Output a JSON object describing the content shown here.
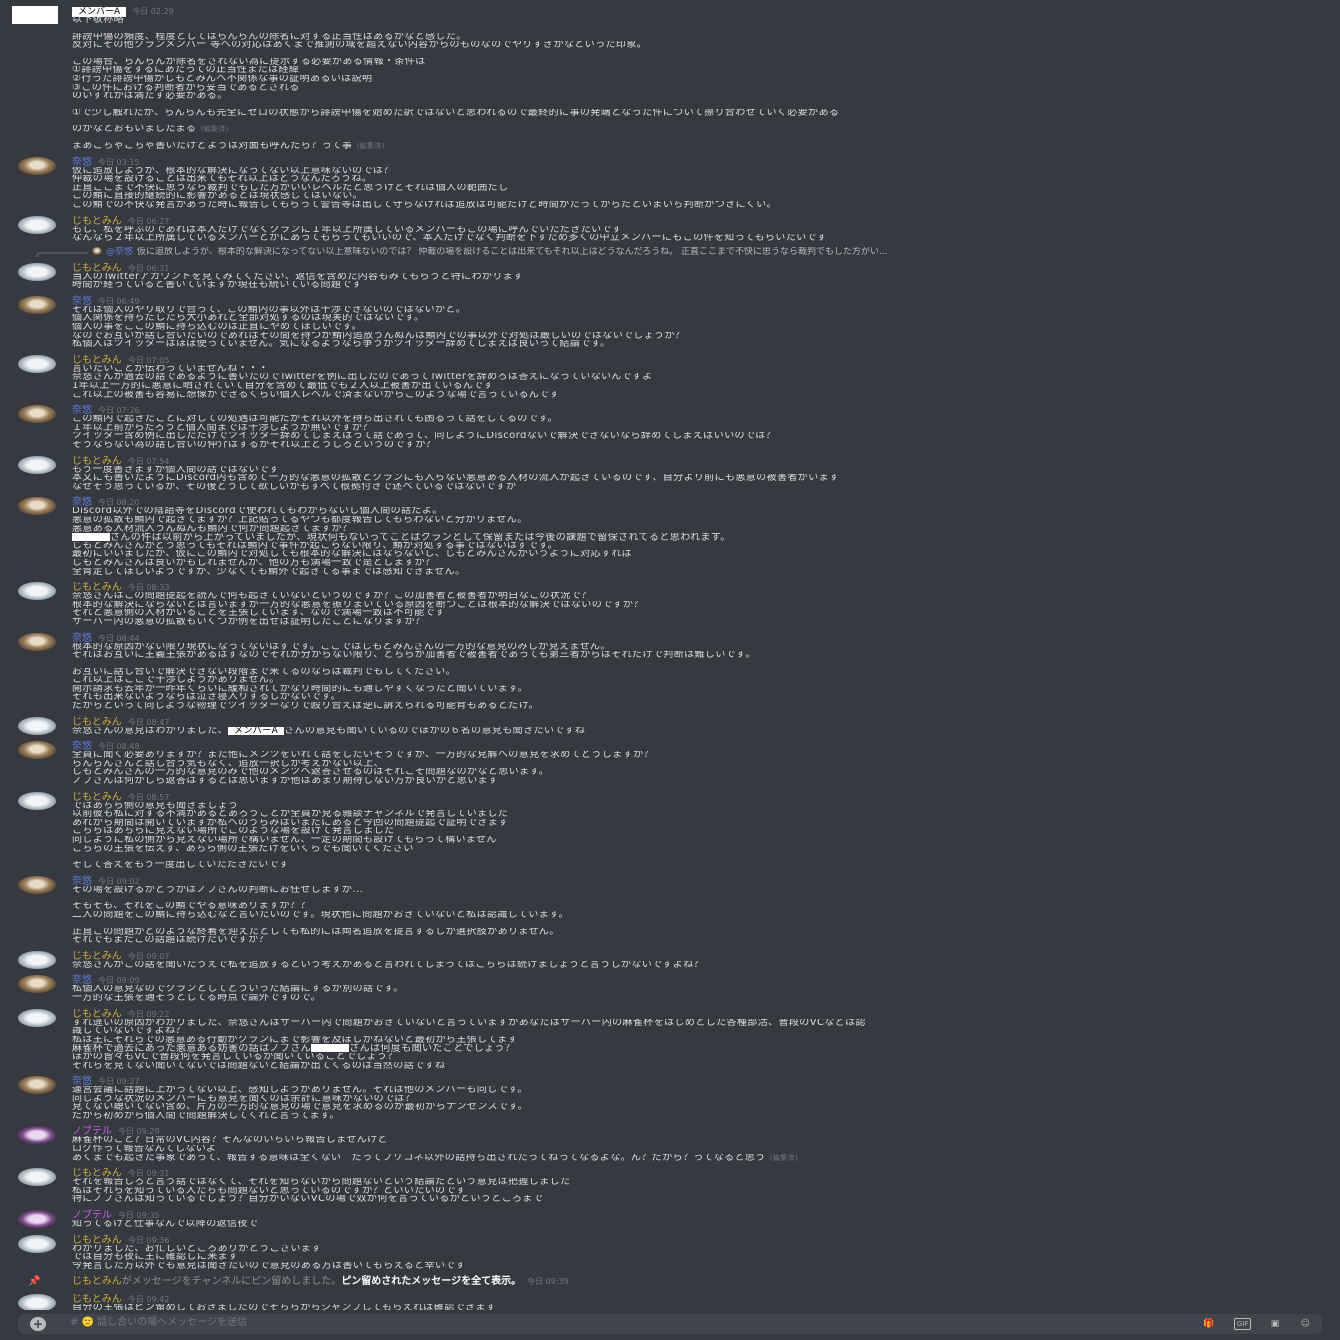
{
  "channel": {
    "composer_placeholder": "# 🙂 話し合いの場へメッセージを送信",
    "composer_icons": [
      "gift-icon",
      "gif-button",
      "sticker-icon",
      "emoji-icon"
    ],
    "gif_label": "GIF"
  },
  "messages": [
    {
      "id": "m1",
      "author": "メンバーA",
      "author_style": "redact",
      "avatar": "blank",
      "time": "今日 02:29",
      "head": true,
      "lines": [
        "以下敬称略",
        "",
        "誹謗中傷の頻度、程度としてはらんらんの除名に対する正当性はあるかなと感じた。",
        "反対にその他クランメンバー 等への対応はあくまで推測の域を超えない内容からのものなのでやりすぎかなといった印象。",
        "",
        "この場合、らんらんが除名をされない為に提示する必要がある情報・条件は",
        "①誹謗中傷をするにあたっての正当性または経緯",
        "②行った誹謗中傷がじもとみんへ不関係な事の証明あるいは説明",
        "③この件における判断者から妥当であるとされる",
        "のいずれかは満たす必要がある。",
        "",
        "①で少し触れたが、らんらんも完全にゼロの状態から誹謗中傷を始めた訳ではないと思われるので最終的に事の発端となった件について擦り合わせていく必要がある",
        "",
        "のかなとおもいましたまる",
        "",
        "まあごちゃごちゃ書いたけどようは対面も呼んだら？って事"
      ],
      "edited_lines": [
        13,
        15
      ],
      "edited_label": "(編集済)"
    },
    {
      "id": "m2",
      "author": "奈悠",
      "author_style": "sai",
      "avatar": "cat",
      "time": "今日 03:15",
      "head": true,
      "lines": [
        "仮に追放しようが、根本的な解決になってない以上意味ないのでは？",
        "仲裁の場を設けることは出来てもそれ以上はどうなんだろうね。",
        "正直ここまで不快に思うなら裁判でもした方がいいレベルだと思うけどそれは個人の範囲だし",
        "この鯖に直接的継続的に影響があるとは現状感じてはいない。",
        "この鯖での不快な発言があった時に報告してもらって警告等は出して守らなければ追放は可能だけど時間がたってからだといまいち判断がつきにくい。"
      ]
    },
    {
      "id": "m3",
      "author": "じもとみん",
      "author_style": "jimo",
      "avatar": "sheep",
      "time": "今日 06:27",
      "head": true,
      "lines": [
        "もし、私を呼ぶのであれば本人だけでなくクランに１年以上所属しているメンバーもこの場に呼んでいただきたいです",
        "なんなら２年以上所属しているメンバーとかにあってもらってもいいので、本人だけでなく判断を下すため多くの中立メンバーにもこの件を知ってもらいたいです"
      ]
    },
    {
      "id": "m4",
      "type": "reply",
      "reply_name": "@奈悠",
      "reply_text": "仮に追放しようが、根本的な解決になってない以上意味ないのでは？ 仲裁の場を設けることは出来てもそれ以上はどうなんだろうね。 正直ここまで不快に思うなら裁判でもした方がい...",
      "author": "じもとみん",
      "author_style": "jimo",
      "avatar": "sheep",
      "time": "今日 06:31",
      "head": true,
      "lines": [
        "当人のTwitterアカウントを見てみてください、返信を含めた内容もみてもらうと特にわかります",
        "時間が経っていると書いていますが現在も続いている問題です"
      ]
    },
    {
      "id": "m5",
      "author": "奈悠",
      "author_style": "sai",
      "avatar": "cat",
      "time": "今日 06:49",
      "head": true,
      "lines": [
        "それは個人のやり取りで合って、この鯖内の事以外は干渉できないのではないかと。",
        "個人関係を持ちだしたら大小あれど全部対処するのは現実的ではないです。",
        "個人の事をここの鯖に持ち込むのは正直にやめてほしいです。",
        "なのでお互いが話し合いたいのであればその間を持つが鯖内追放うんぬんは鯖内での事以外で対処は厳しいのではないでしょうか？",
        "私個人はツイッターはほぼ使っていません。気になるようなら争うかツイッター辞めてしまえば良いって結論です。"
      ]
    },
    {
      "id": "m6",
      "author": "じもとみん",
      "author_style": "jimo",
      "avatar": "sheep",
      "time": "今日 07:05",
      "head": true,
      "lines": [
        "言いたいことが伝わっていませんね・・・",
        "奈悠さんが過去の話であるように書いたのでTwitterを例に出したのであってTwitterを辞めろは答えになっていないんですよ",
        "1年以上一方的に悪意に晒されていて自分を含めて最低でも２人以上被害が出ているんです",
        "これ以上の被害も容易に想像ができるくらい個人レベルで済まないからこのような場で言っているんです"
      ]
    },
    {
      "id": "m7",
      "author": "奈悠",
      "author_style": "sai",
      "avatar": "cat",
      "time": "今日 07:26",
      "head": true,
      "lines": [
        "この鯖内で起きたことに対しての処遇は可能だがそれ以外を持ち出されても困るって話をしてるのです。",
        "１年以上前からだろうと個人間までは干渉しようが無いですか？",
        "ツイッター含め例に出しただけでツイッター辞めてしまえばって話であって、同じようにDiscordないで解決できないなら辞めてしまえばいいのでは？",
        "そうならない為の話し合いの仲介はするがそれ以上どうしろというのですか？"
      ]
    },
    {
      "id": "m8",
      "author": "じもとみん",
      "author_style": "jimo",
      "avatar": "sheep",
      "time": "今日 07:54",
      "head": true,
      "lines": [
        "もう一度書きますが個人間の話ではないです",
        "本文にも書いたようにDiscord内も含めて一方的な悪意の拡散とクランにも入らない悪意ある人材の流入が起きているのです、自分より前にも悪意の被害者がいます",
        "なぜそう思っているか、その後どうして欲しいかもすべて根拠付きで述べているではないですか"
      ]
    },
    {
      "id": "m9",
      "author": "奈悠",
      "author_style": "sai",
      "avatar": "cat",
      "time": "今日 08:20",
      "head": true,
      "lines": [
        "Discord以外での陰語等をDiscordで使われてもわからないし個人間の話だよ。",
        "悪意の拡散も鯖内で起きてますか？上記貼ってるやつも都度報告してもらわないと分かりません。",
        "悪意ある人材流入うんぬんも鯖内で何か問題起きてますか？",
        "[R]さんの件は以前から上がっていましたが、現状何もないってことはクランとして保留または今後の課題で留保されてると思われます。",
        "じもとみんさんがどう思ってもそれは鯖内で事件が起こらない限り、鯖が対処する事ではないはずです。",
        "最初にいいましたが、仮にこの鯖内で対処しても根本的な解決にはならないし、じもとみんさんがいうように対応すれば",
        "じもとみんさんは良いかもしれませんが、他の方も満場一致で是としますか？",
        "全肯定してほしいようですが、少なくても鯖外で起きてる事までは感知できません。"
      ]
    },
    {
      "id": "m10",
      "author": "じもとみん",
      "author_style": "jimo",
      "avatar": "sheep",
      "time": "今日 08:33",
      "head": true,
      "lines": [
        "奈悠さんはこの問題提起を読んで何も起きていないというのですか？この加害者と被害者が明白なこの状況で？",
        "根本的な解決にならないとは言いますが一方的な悪意を振りまいている原因を断つことは根本的な解決ではないのですか？",
        "それと悪意側の人材がいることを主張しています、なので満場一致は不可能です",
        "サーバー内の悪意の拡散もいくつか例を出せば証明したことになりますか？"
      ]
    },
    {
      "id": "m11",
      "author": "奈悠",
      "author_style": "sai",
      "avatar": "cat",
      "time": "今日 08:44",
      "head": true,
      "lines": [
        "根本的な原因がない限り現状になってないはずです。ここではじもとみんさんの一方的な意見のみしか見えません。",
        "それはお互いに主義主張があるはずなのでそれが分からない限り、どちらが加害者で被害者であっても第三者からはそれだけで判断は難しいです。",
        "",
        "お互いに話し合いで解決できない段階まで来てるのならば裁判でもしてください。",
        "これ以上はここで干渉しようがありません。",
        "開示請求も去年か一昨年くらいに緩和されてかなり時間的にも通しやすくなったと聞いています。",
        "それも出来ないようならば泣き寝入りするしかないです。",
        "だからといって同じような物理でツイッターなりで殴り合えば逆に訴えられる可能背もあるとだけ。"
      ]
    },
    {
      "id": "m12",
      "author": "じもとみん",
      "author_style": "jimo",
      "avatar": "sheep",
      "time": "今日 08:47",
      "head": true,
      "lines": [
        "奈悠さんの意見はわかりました、[メンバーA]さんの意見も聞いているのでほかの６名の意見も聞きたいですね"
      ]
    },
    {
      "id": "m13",
      "author": "奈悠",
      "author_style": "sai",
      "avatar": "cat",
      "time": "今日 08:48",
      "head": true,
      "lines": [
        "全員に聞く必要ありますか？また他にメンツをいれて話をしたいそうですが、一方的な見解への意見を求めてどうしますか？",
        "らんらんさんと話し合う気もなく、追放一択しか考えがない以上、",
        "じもとみんさんの一方的な意見のみで他のメンツへ返答させるのはそれこそ問題なのかなと思います。",
        "ノブさんは何かしら返答はするとは思いますが他はあまり期待しない方が良いかと思います"
      ]
    },
    {
      "id": "m14",
      "author": "じもとみん",
      "author_style": "jimo",
      "avatar": "sheep",
      "time": "今日 08:57",
      "head": true,
      "lines": [
        "ではあちら側の意見も聞きましょう",
        "以前彼も私に対する不満があるとあろうことか全員が見る雑談チャンネルで発言していました",
        "あれから期間は開いていますが私へのうらみはいまだにあると今回の問題提起で証明できます",
        "こちらはあちらに見えない場所でこのような場を設けて発言しました",
        "同じように私の側から見えない場所で構いません、一定の期間も設けてもらって構いません",
        "こちらの主張を伝えず、あちら側の主張だけをいくらでも聞いてください",
        "",
        "そして答えをもう一度出していただきたいです"
      ]
    },
    {
      "id": "m15",
      "author": "奈悠",
      "author_style": "sai",
      "avatar": "cat",
      "time": "今日 09:02",
      "head": true,
      "lines": [
        "その場を設けるかどうかはノブさんの判断にお任せしますが...",
        "",
        "そもそも、それをこの鯖でやる意味ありますか？？",
        "二人の問題をこの鯖に持ち込むなと言いたいのです。現状他に問題がおきていないと私は認識しています。",
        "",
        "正直この問題がどのような終着を迎えたとしても私的には両名追放を提言するしか選択肢がありません。",
        "それでもまだこの話題は続けたいですか？"
      ]
    },
    {
      "id": "m16",
      "author": "じもとみん",
      "author_style": "jimo",
      "avatar": "sheep",
      "time": "今日 09:07",
      "head": true,
      "lines": [
        "奈悠さんがこの話を聞いたうえで私を追放するという考えがあると言われてしまってはこちらは続けましょうと言うしかないですよね？"
      ]
    },
    {
      "id": "m17",
      "author": "奈悠",
      "author_style": "sai",
      "avatar": "cat",
      "time": "今日 09:09",
      "head": true,
      "lines": [
        "私個人の意見なのでクランとしてどういった結論にするか別の話です。",
        "一方的な主張を通そうとしてる時点で論外ですので。"
      ]
    },
    {
      "id": "m18",
      "author": "じもとみん",
      "author_style": "jimo",
      "avatar": "sheep",
      "time": "今日 09:22",
      "head": true,
      "lines": [
        "すれ違いの原因がわかりました、奈悠さんはサーバー内で問題がおきていないと言っていますがあなたはサーバー内の麻雀杯をはじめとした各種部活、普段のVCなどは認",
        "識していないですよね？",
        "私は主にそれらでの悪意ある行動がクランにまで影響を及ぼしかねないと最初から主張してます",
        "麻雀杯で過去にあった悪意ある妨害の話はノブさん[R]さんは何度も聞いたことでしょう？",
        "ほかの皆々もVCで普段何を発言しているか聞いていることでしょう？",
        "それらを見てない聞いてないでは問題ないと結論が出てくるのは当然の話ですね"
      ]
    },
    {
      "id": "m19",
      "author": "奈悠",
      "author_style": "sai",
      "avatar": "cat",
      "time": "今日 09:27",
      "head": true,
      "lines": [
        "運営会議に話題に上がってない以上、感知しようがありません。それは他のメンバーも同じです。",
        "同じような状況のメンバーにも意見を聞くのは余計に意味がないのでは？",
        "見てない聴いてない含め、片方の一方的な意見の場で意見を求めるのが最初からナンセンスです。",
        "だから初めから個人間で問題解決してくれと言ってます。"
      ]
    },
    {
      "id": "m20",
      "author": "ノブテル",
      "author_style": "nobu",
      "avatar": "purple",
      "time": "今日 09:29",
      "head": true,
      "lines": [
        "麻雀杯のこと？日常のVC内容？そんなのいちいち報告しませんけど",
        "ログ作って報告なんてしないよ",
        "あくまでも起きた事象であって、報告する意味は全くない　だってプリコネ以外の話持ち出されたってねってなるよな。ん？だから？ってなると思う"
      ],
      "edited_lines": [
        2
      ],
      "edited_label": "(編集済)"
    },
    {
      "id": "m21",
      "author": "じもとみん",
      "author_style": "jimo",
      "avatar": "sheep",
      "time": "今日 09:31",
      "head": true,
      "lines": [
        "それを報告しろと言う話ではなくて、それを知らないから問題ないという結論だという意見は把握しました",
        "私はそれらを知っている人たちも問題ないと思っているのですか？といいたいのです",
        "特にノブさんは知っているでしょう？自分がいないVCの場で奴が何を言っているかというところまで"
      ]
    },
    {
      "id": "m22",
      "author": "ノブテル",
      "author_style": "nobu",
      "avatar": "purple",
      "time": "今日 09:35",
      "head": true,
      "lines": [
        "知ってるけど仕事なんで以降の返信夜で"
      ]
    },
    {
      "id": "m23",
      "author": "じもとみん",
      "author_style": "jimo",
      "avatar": "sheep",
      "time": "今日 09:36",
      "head": true,
      "lines": [
        "わかりました、お忙しいところありがとうございます",
        "では自分も夜に主に確認しに来ます",
        "今発言した方以外でも意見は聞きたいので意見のある方は書いてもらえると幸いです"
      ]
    },
    {
      "id": "m24",
      "type": "system",
      "author": "じもとみん",
      "text": "がメッセージをチャンネルにピン留めしました。",
      "link": "ピン留めされたメッセージを全て表示。",
      "time": "今日 09:39"
    },
    {
      "id": "m25",
      "author": "じもとみん",
      "author_style": "jimo",
      "avatar": "sheep",
      "time": "今日 09:42",
      "head": true,
      "lines": [
        "自分の主張はピン留めしておきましたのでそちらからジャンプしてもらえれば確認できます"
      ]
    }
  ]
}
